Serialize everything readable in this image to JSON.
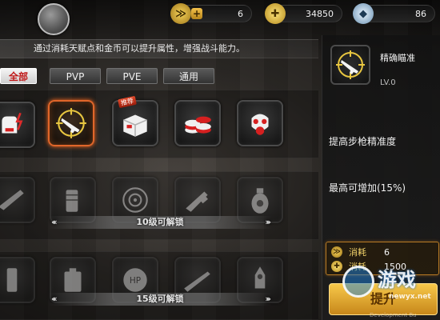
{
  "top": {
    "rank_points": "6",
    "gold": "34850",
    "diamonds": "86"
  },
  "panel": {
    "description": "通过消耗天赋点和金币可以提升属性，增强战斗能力。",
    "tabs": [
      {
        "label": "全部",
        "active": true
      },
      {
        "label": "PVP",
        "active": false
      },
      {
        "label": "PVE",
        "active": false
      },
      {
        "label": "通用",
        "active": false
      }
    ],
    "tier1_slots": [
      {
        "icon": "gloves-lightning-icon"
      },
      {
        "icon": "crosshair-rifle-icon",
        "selected": true
      },
      {
        "icon": "supply-box-icon",
        "tag": "推荐"
      },
      {
        "icon": "coin-stack-icon"
      },
      {
        "icon": "gas-mask-icon"
      }
    ],
    "tier2_slots": [
      {
        "icon": "rifle-icon"
      },
      {
        "icon": "ammo-magazine-icon"
      },
      {
        "icon": "target-icon"
      },
      {
        "icon": "shotgun-icon"
      },
      {
        "icon": "biohazard-grenade-icon"
      }
    ],
    "tier2_unlock": "10级可解锁",
    "tier3_slots": [
      {
        "icon": "ammo-clip-icon"
      },
      {
        "icon": "battery-icon"
      },
      {
        "icon": "hp-medkit-icon"
      },
      {
        "icon": "sniper-rifle-icon"
      },
      {
        "icon": "rocket-icon"
      }
    ],
    "tier3_unlock": "15级可解锁"
  },
  "detail": {
    "name": "精确瞄准",
    "level": "LV.0",
    "description": "提高步枪精准度",
    "max_bonus": "最高可增加(15%)",
    "cost_label": "消耗",
    "cost_talent": "6",
    "cost_gold": "1500",
    "upgrade_label": "提升"
  },
  "watermark": {
    "text": "游戏",
    "site": "newyx.net"
  },
  "dev_build": "Development Bu"
}
